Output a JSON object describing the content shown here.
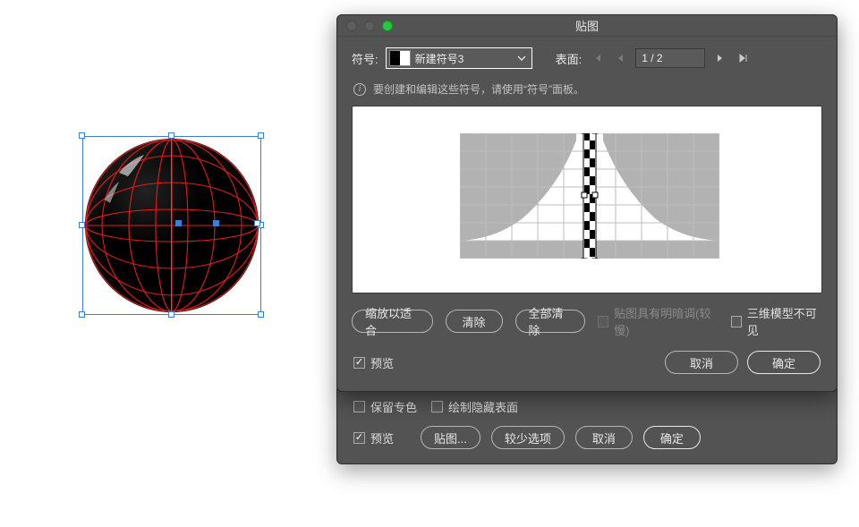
{
  "front": {
    "title": "贴图",
    "symbol_label": "符号:",
    "symbol_name": "新建符号3",
    "surface_label": "表面:",
    "surface_value": "1 / 2",
    "hint": "要创建和编辑这些符号，请使用“符号”面板。",
    "btn_fit": "缩放以适合",
    "btn_clear": "清除",
    "btn_clear_all": "全部清除",
    "chk_shade": "贴图具有明暗调(较慢)",
    "chk_invisible": "三维模型不可见",
    "chk_preview": "预览",
    "btn_cancel": "取消",
    "btn_ok": "确定"
  },
  "back": {
    "chk_spot": "保留专色",
    "chk_hidden": "绘制隐藏表面",
    "chk_preview": "预览",
    "btn_map": "贴图...",
    "btn_less": "较少选项",
    "btn_cancel": "取消",
    "btn_ok": "确定"
  }
}
